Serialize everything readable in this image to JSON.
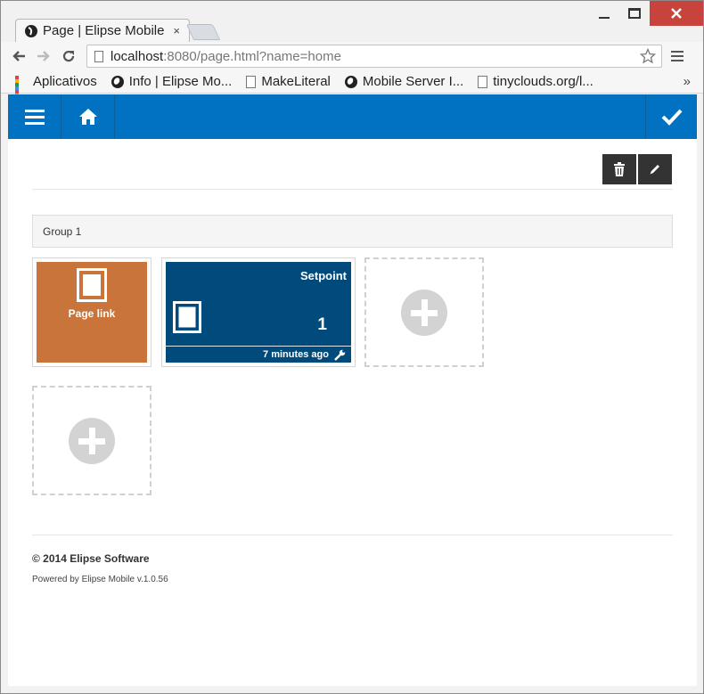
{
  "browser": {
    "tab_title": "Page | Elipse Mobile",
    "tab_close": "×",
    "url_host": "localhost",
    "url_path": ":8080/page.html?name=home",
    "bookmarks": [
      {
        "label": "Aplicativos",
        "icon": "apps-grid-icon"
      },
      {
        "label": "Info | Elipse Mo...",
        "icon": "globe-icon"
      },
      {
        "label": "MakeLiteral",
        "icon": "page-icon"
      },
      {
        "label": "Mobile Server I...",
        "icon": "globe-icon"
      },
      {
        "label": "tinyclouds.org/l...",
        "icon": "page-icon"
      }
    ],
    "bookmarks_more": "»"
  },
  "appbar": {
    "color": "#0072c1",
    "icons": [
      "menu-icon",
      "home-icon",
      "check-icon"
    ]
  },
  "actions": {
    "icons": [
      "trash-icon",
      "pencil-icon"
    ]
  },
  "group": {
    "title": "Group 1"
  },
  "tiles": {
    "page_link": {
      "label": "Page link",
      "color": "#c8743a"
    },
    "setpoint": {
      "title": "Setpoint",
      "value": "1",
      "updated": "7 minutes ago",
      "color": "#004b7c"
    }
  },
  "footer": {
    "copyright": "© 2014 Elipse Software",
    "powered": "Powered by Elipse Mobile v.1.0.56"
  }
}
